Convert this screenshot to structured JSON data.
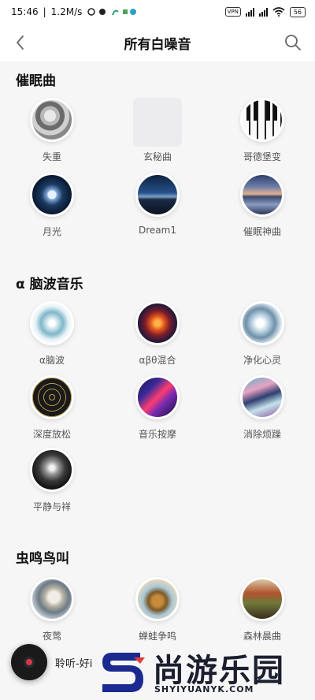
{
  "status_bar": {
    "time": "15:46",
    "speed": "1.2M/s",
    "vpn": "VPN",
    "battery": "56"
  },
  "header": {
    "title": "所有白噪音"
  },
  "sections": [
    {
      "title": "催眠曲",
      "items": [
        {
          "label": "失重"
        },
        {
          "label": "玄秘曲"
        },
        {
          "label": "哥德堡变"
        },
        {
          "label": "月光"
        },
        {
          "label": "Dream1"
        },
        {
          "label": "催眠神曲"
        }
      ]
    },
    {
      "title": "α 脑波音乐",
      "items": [
        {
          "label": "α脑波"
        },
        {
          "label": "αβθ混合"
        },
        {
          "label": "净化心灵"
        },
        {
          "label": "深度放松"
        },
        {
          "label": "音乐按摩"
        },
        {
          "label": "消除烦躁"
        },
        {
          "label": "平静与祥"
        }
      ]
    },
    {
      "title": "虫鸣鸟叫",
      "items": [
        {
          "label": "夜莺"
        },
        {
          "label": "蝉蛙争鸣"
        },
        {
          "label": "森林晨曲"
        }
      ]
    }
  ],
  "player": {
    "text": "聆听-好i"
  },
  "watermark": {
    "title": "尚游乐园",
    "subtitle": "SHYIYUANYK.COM"
  }
}
